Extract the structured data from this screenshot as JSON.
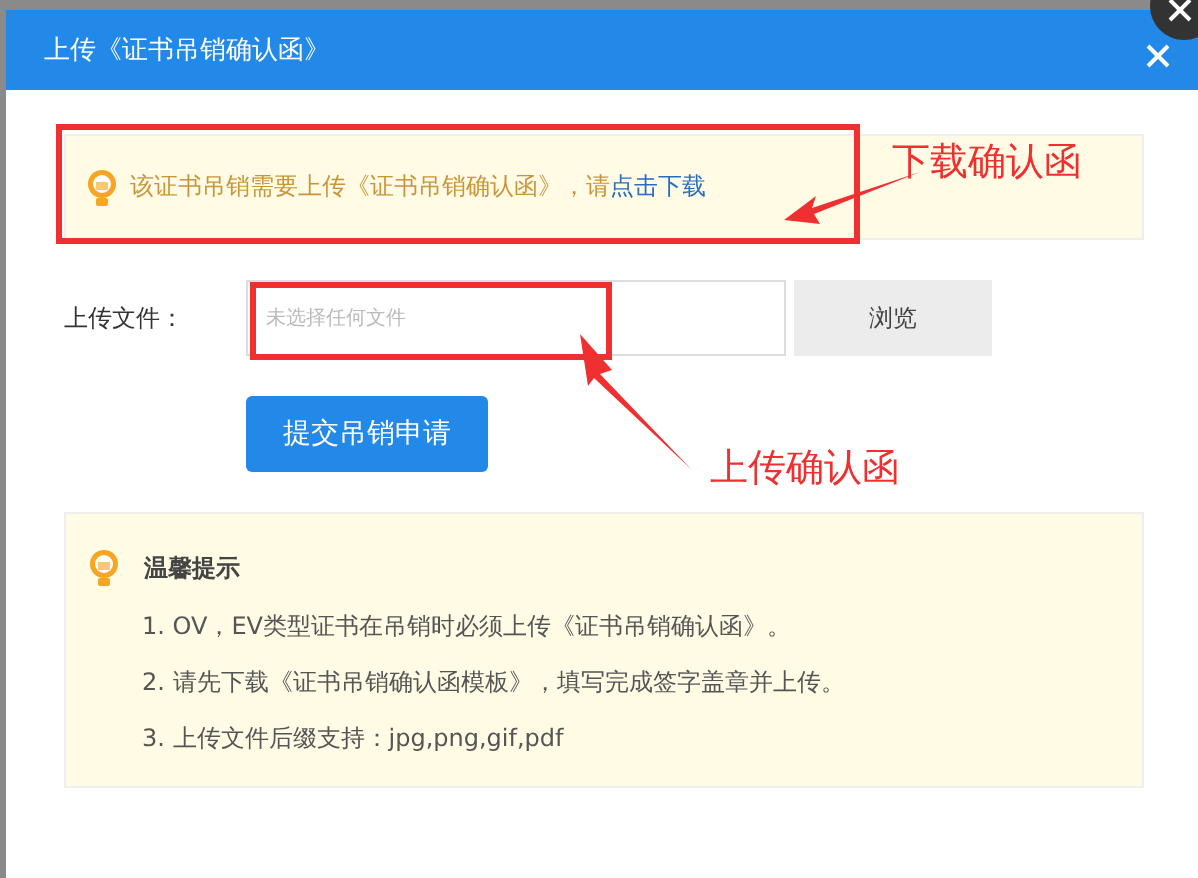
{
  "dialog": {
    "title": "上传《证书吊销确认函》"
  },
  "notice": {
    "text": "该证书吊销需要上传《证书吊销确认函》，请",
    "link": "点击下载"
  },
  "upload": {
    "label": "上传文件：",
    "placeholder": "未选择任何文件",
    "browse": "浏览"
  },
  "submit": "提交吊销申请",
  "tips": {
    "title": "温馨提示",
    "items": [
      "1. OV，EV类型证书在吊销时必须上传《证书吊销确认函》。",
      "2. 请先下载《证书吊销确认函模板》，填写完成签字盖章并上传。",
      "3. 上传文件后缀支持：jpg,png,gif,pdf"
    ]
  },
  "annotations": [
    {
      "text": "下载确认函"
    },
    {
      "text": "上传确认函"
    }
  ]
}
